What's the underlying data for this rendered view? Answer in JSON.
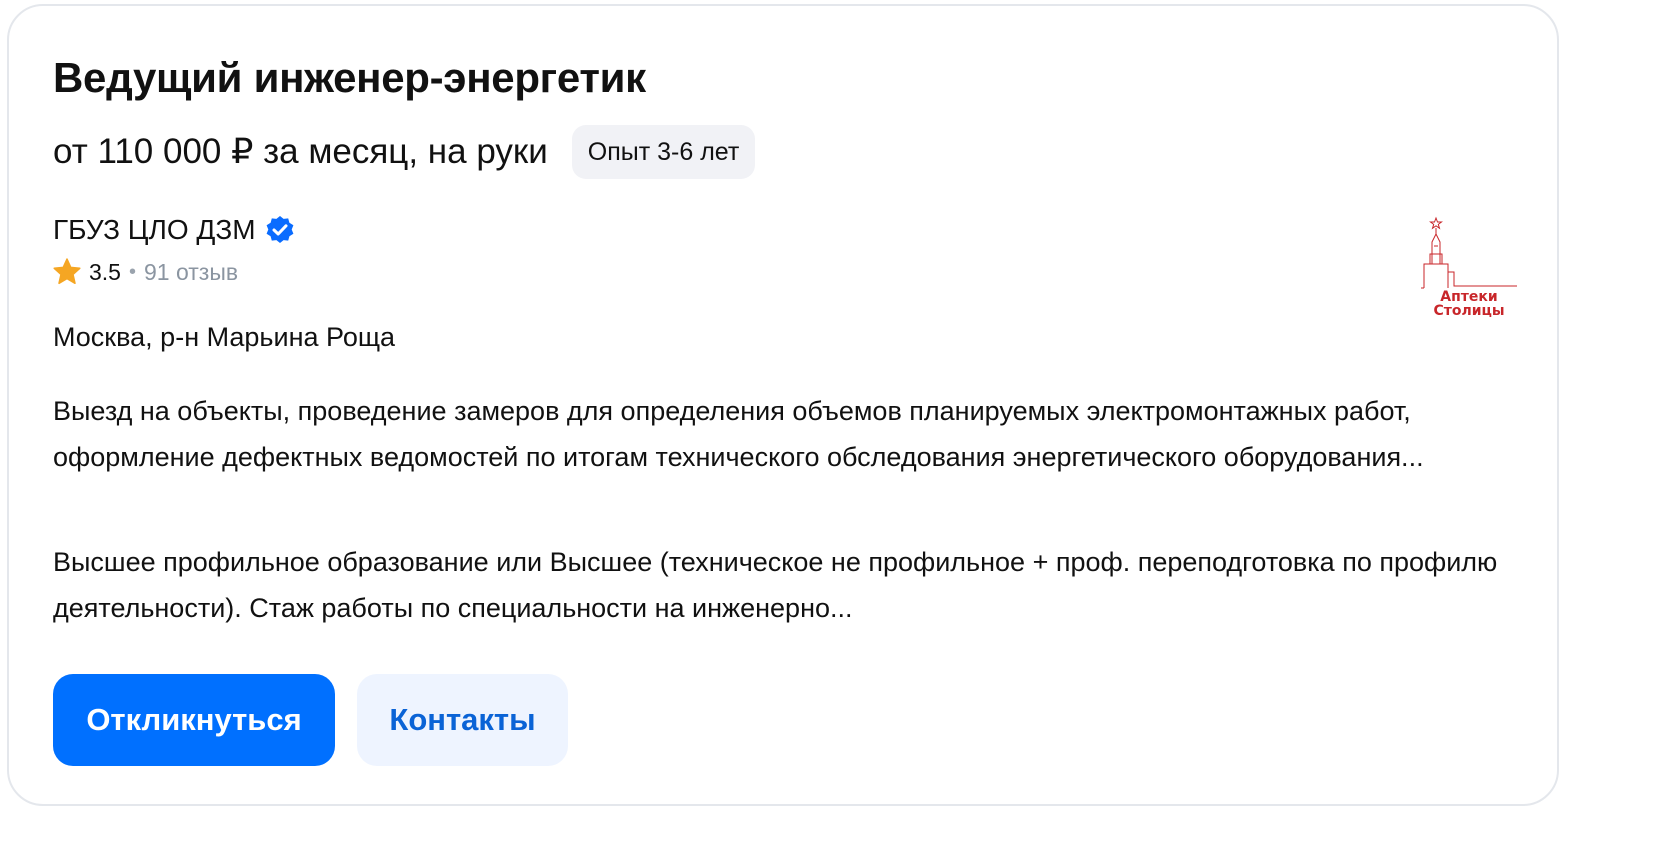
{
  "vacancy": {
    "title": "Ведущий инженер-энергетик",
    "salary": "от 110 000 ₽ за месяц, на руки",
    "experience_badge": "Опыт 3-6 лет",
    "company": {
      "name": "ГБУЗ ЦЛО ДЗМ",
      "verified_icon": "verified-check-icon",
      "rating": "3.5",
      "separator": "•",
      "reviews": "91 отзыв",
      "logo_text": "Аптеки Столицы"
    },
    "location": "Москва, р-н Марьина Роща",
    "responsibilities": "Выезд на объекты, проведение замеров для определения объемов планируемых электромонтажных работ, оформление дефектных ведомостей по итогам технического обследования энергетического оборудования...",
    "requirements": "Высшее профильное образование или Высшее (техническое не профильное + проф. переподготовка по профилю деятельности). Стаж работы по специальности на инженерно..."
  },
  "actions": {
    "apply_label": "Откликнуться",
    "contacts_label": "Контакты"
  },
  "colors": {
    "accent": "#0070ff",
    "secondary_button_bg": "#eef4ff",
    "badge_bg": "#f1f2f6",
    "star": "#f5a623",
    "logo_red": "#c8262a",
    "verified": "#0a6cff"
  }
}
